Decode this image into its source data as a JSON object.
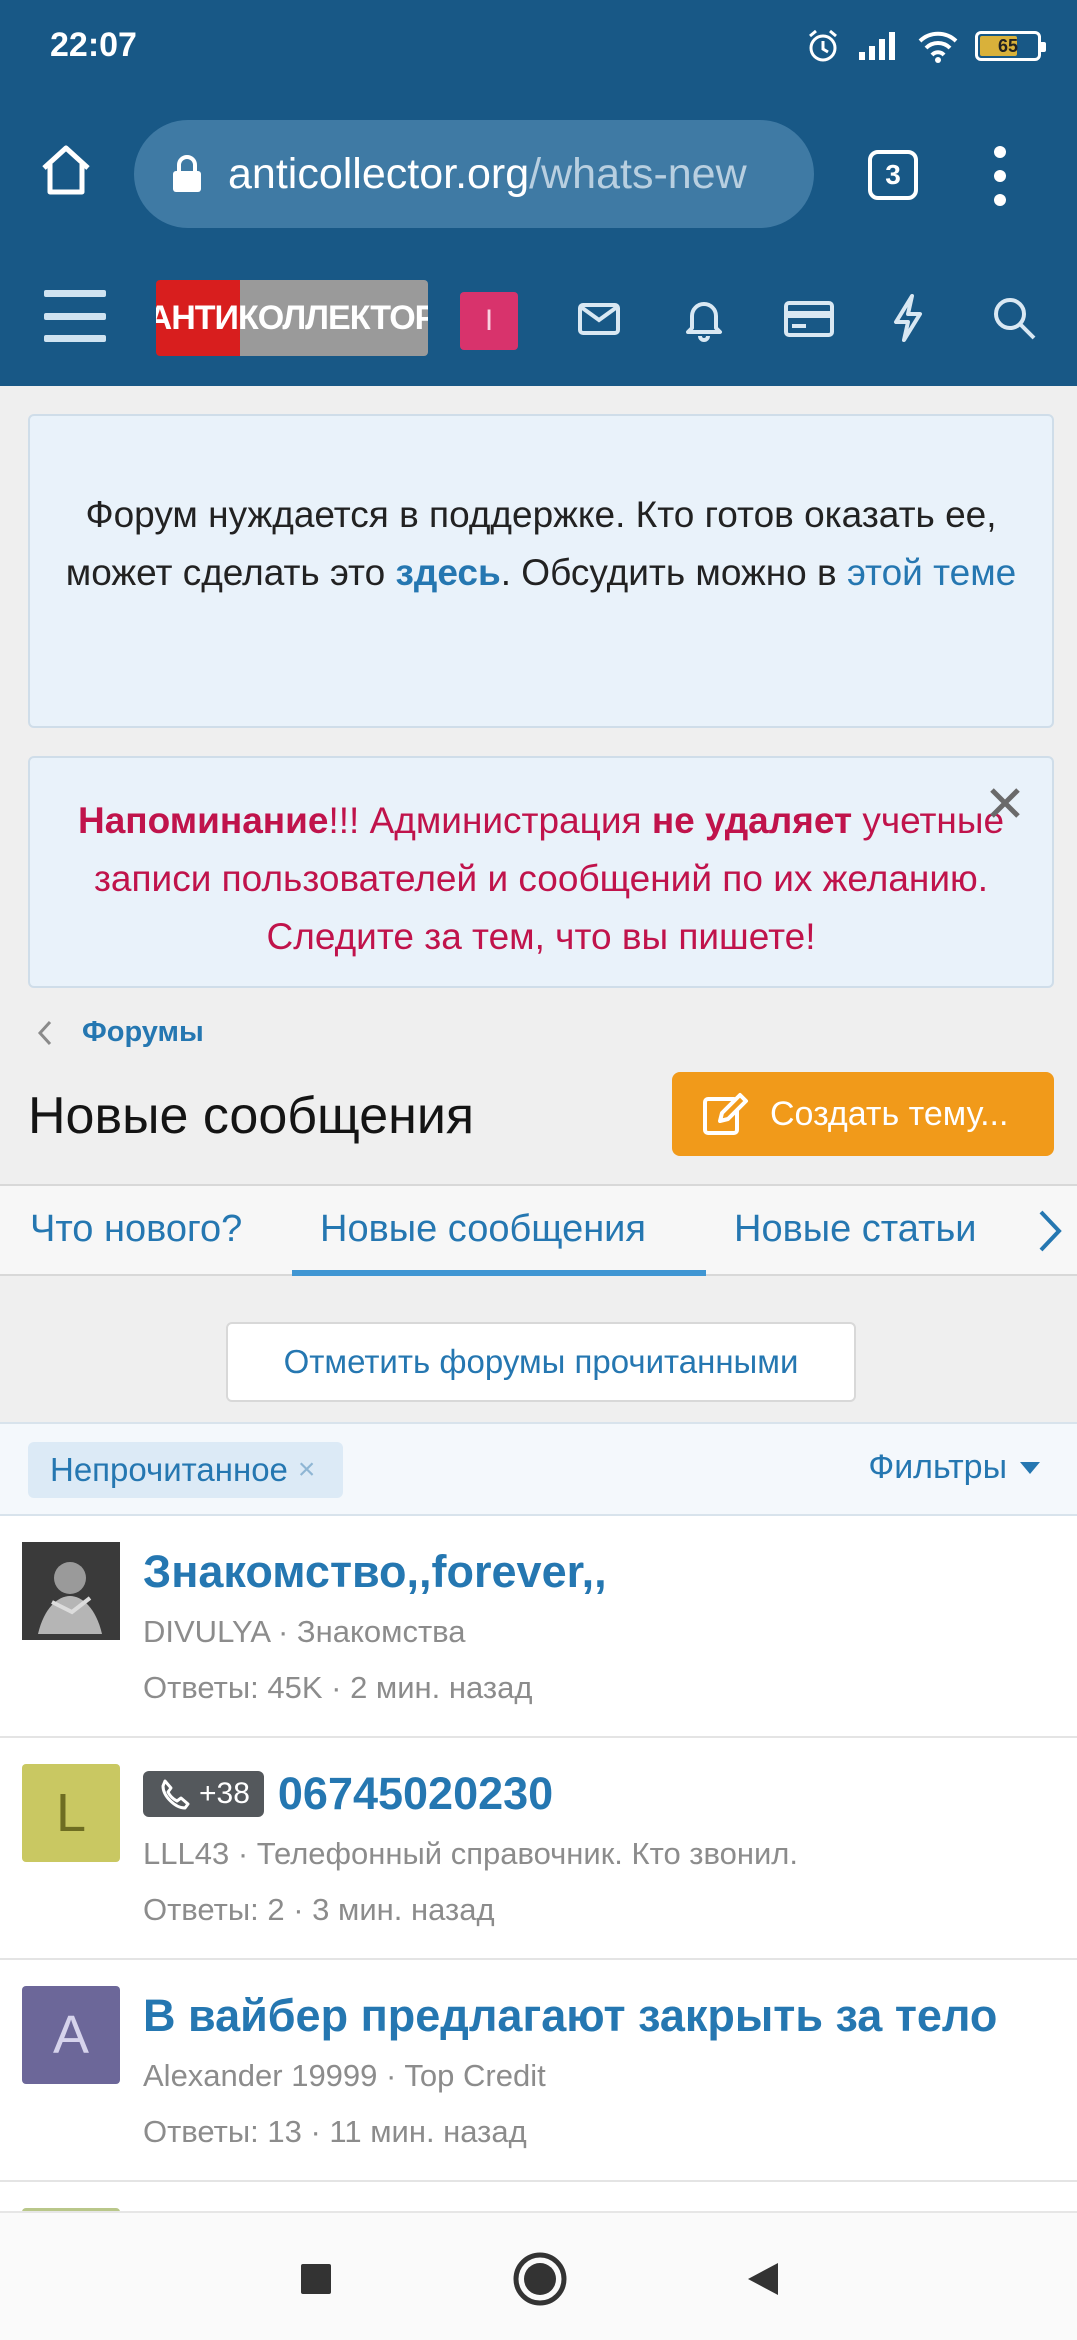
{
  "status_bar": {
    "time": "22:07",
    "battery": "65"
  },
  "browser": {
    "url_host": "anticollector.org",
    "url_path": "/whats-new",
    "tab_count": "3"
  },
  "site_header": {
    "logo_text": "АНТИКОЛЛЕКТОР",
    "user_initial": "I"
  },
  "notices": {
    "support": {
      "text_before": "Форум нуждается в поддержке. Кто готов оказать ее, может сделать это ",
      "link_here": "здесь",
      "text_mid": ". Обсудить можно в ",
      "link_topic": "этой теме"
    },
    "reminder": {
      "title": "Напоминание",
      "excl": "!!! Администрация ",
      "bold": "не удаляет",
      "rest": " учетные записи пользователей и сообщений по их желанию. Следите за тем, что вы пишете!"
    }
  },
  "breadcrumb": {
    "label": "Форумы"
  },
  "page": {
    "title": "Новые сообщения",
    "create_button": "Создать тему..."
  },
  "tabs": [
    {
      "label": "Что нового?"
    },
    {
      "label": "Новые сообщения"
    },
    {
      "label": "Новые статьи"
    }
  ],
  "mark_read_button": "Отметить форумы прочитанными",
  "filters": {
    "chip": "Непрочитанное",
    "chip_remove": "×",
    "filters_label": "Фильтры"
  },
  "threads": [
    {
      "title": "Знакомство,,forever,,",
      "prefix": "",
      "author": "DIVULYA",
      "forum": "Знакомства",
      "replies": "Ответы: 45K",
      "time": "2 мин. назад",
      "avatar_letter": "",
      "avatar_color": "#6a6a6a"
    },
    {
      "title": "06745020230",
      "prefix": "+38",
      "author": "LLL43",
      "forum": "Телефонный справочник. Кто звонил.",
      "replies": "Ответы: 2",
      "time": "3 мин. назад",
      "avatar_letter": "L",
      "avatar_color": "#c9c862"
    },
    {
      "title": "В вайбер предлагают закрыть за тело",
      "prefix": "",
      "author": "Alexander 19999",
      "forum": "Top Credit",
      "replies": "Ответы: 13",
      "time": "11 мин. назад",
      "avatar_letter": "A",
      "avatar_color": "#6c6799"
    }
  ],
  "colors": {
    "brand": "#185886",
    "link": "#2577b1",
    "accent_button": "#f19a1a",
    "alert_text": "#c0134b"
  }
}
